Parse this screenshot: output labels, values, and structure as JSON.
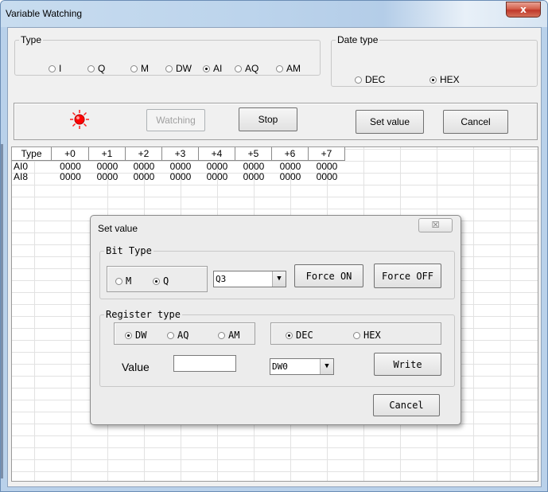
{
  "window": {
    "title": "Variable Watching",
    "close_glyph": "x"
  },
  "type_group": {
    "legend": "Type",
    "options": [
      {
        "label": "I",
        "selected": false
      },
      {
        "label": "Q",
        "selected": false
      },
      {
        "label": "M",
        "selected": false
      },
      {
        "label": "DW",
        "selected": false
      },
      {
        "label": "AI",
        "selected": true
      },
      {
        "label": "AQ",
        "selected": false
      },
      {
        "label": "AM",
        "selected": false
      }
    ]
  },
  "date_type_group": {
    "legend": "Date type",
    "options": [
      {
        "label": "DEC",
        "selected": false
      },
      {
        "label": "HEX",
        "selected": true
      }
    ]
  },
  "toolbar": {
    "indicator_color": "#ff0000",
    "watching_label": "Watching",
    "stop_label": "Stop",
    "set_value_label": "Set value",
    "cancel_label": "Cancel"
  },
  "table": {
    "headers": [
      "Type",
      "+0",
      "+1",
      "+2",
      "+3",
      "+4",
      "+5",
      "+6",
      "+7"
    ],
    "rows": [
      [
        "AI0",
        "0000",
        "0000",
        "0000",
        "0000",
        "0000",
        "0000",
        "0000",
        "0000"
      ],
      [
        "AI8",
        "0000",
        "0000",
        "0000",
        "0000",
        "0000",
        "0000",
        "0000",
        "0000"
      ]
    ]
  },
  "set_value_dialog": {
    "title": "Set value",
    "close_glyph": "☒",
    "bit_type": {
      "legend": "Bit Type",
      "options": [
        {
          "label": "M",
          "selected": false
        },
        {
          "label": "Q",
          "selected": true
        }
      ],
      "selected_address": "Q3",
      "force_on_label": "Force ON",
      "force_off_label": "Force OFF"
    },
    "register_type": {
      "legend": "Register type",
      "options": [
        {
          "label": "DW",
          "selected": true
        },
        {
          "label": "AQ",
          "selected": false
        },
        {
          "label": "AM",
          "selected": false
        }
      ],
      "format_options": [
        {
          "label": "DEC",
          "selected": true
        },
        {
          "label": "HEX",
          "selected": false
        }
      ],
      "value_label": "Value",
      "value_input": "",
      "selected_register": "DW0",
      "write_label": "Write"
    },
    "cancel_label": "Cancel"
  }
}
